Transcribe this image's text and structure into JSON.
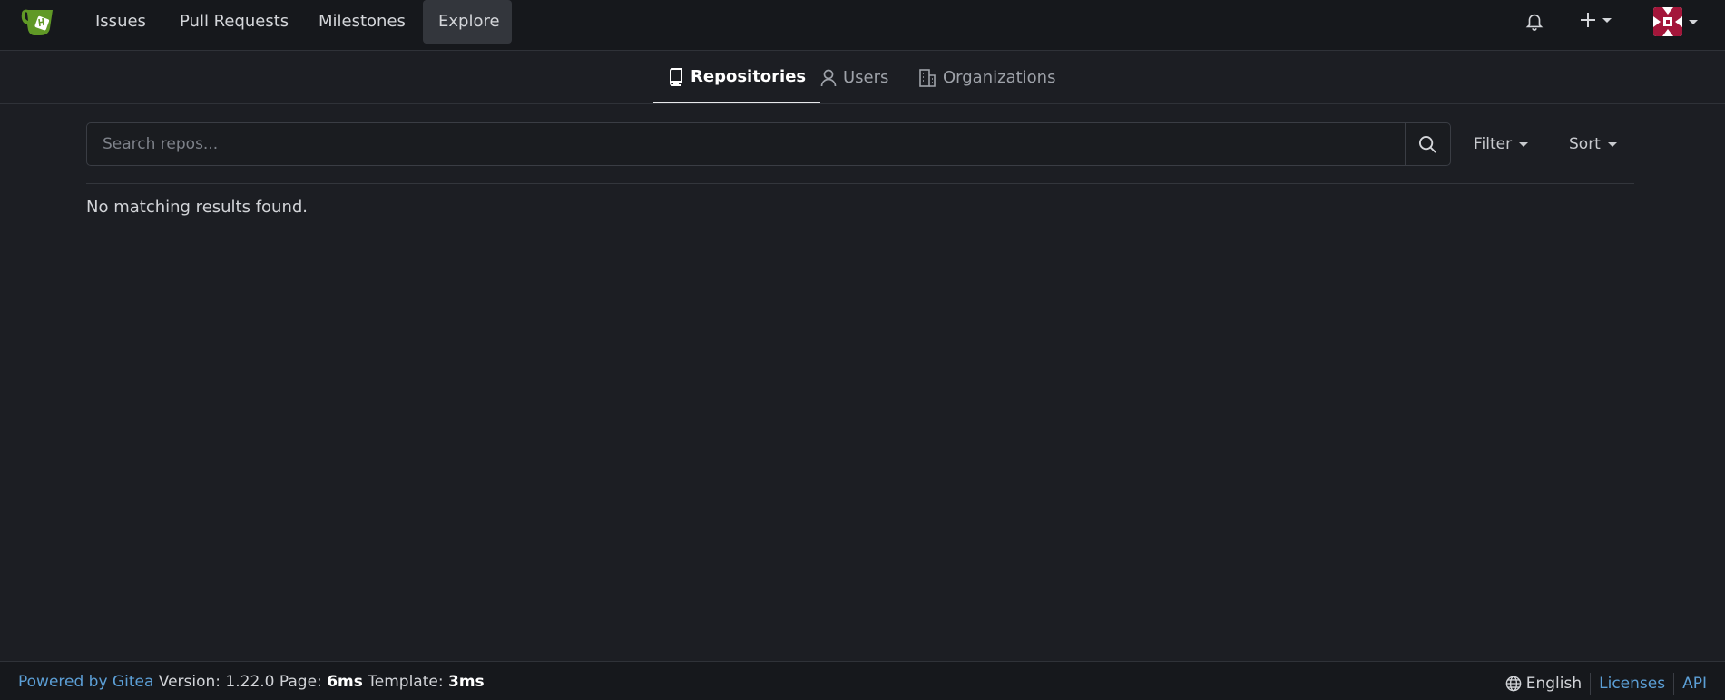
{
  "nav": {
    "items": [
      {
        "label": "Issues"
      },
      {
        "label": "Pull Requests"
      },
      {
        "label": "Milestones"
      },
      {
        "label": "Explore"
      }
    ],
    "active": "Explore"
  },
  "tabs": [
    {
      "label": "Repositories",
      "icon": "repo-icon"
    },
    {
      "label": "Users",
      "icon": "person-icon"
    },
    {
      "label": "Organizations",
      "icon": "organization-icon"
    }
  ],
  "search": {
    "placeholder": "Search repos...",
    "value": ""
  },
  "filter_label": "Filter",
  "sort_label": "Sort",
  "empty_message": "No matching results found.",
  "footer": {
    "powered_by": "Powered by Gitea",
    "version_text": "Version: 1.22.0 Page:",
    "page_time": "6ms",
    "template_label": "Template:",
    "template_time": "3ms",
    "language": "English",
    "licenses": "Licenses",
    "api": "API"
  },
  "colors": {
    "background": "#1c1e23",
    "header": "#16181c",
    "link": "#5c9fd6",
    "logo_green": "#609926"
  }
}
